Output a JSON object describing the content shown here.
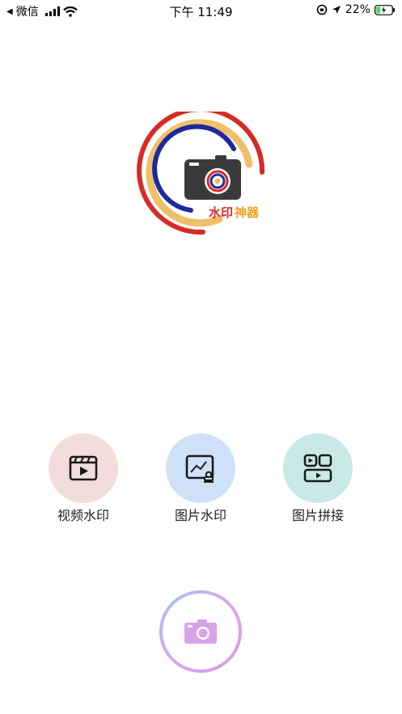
{
  "status_bar": {
    "back_app": "微信",
    "time": "下午 11:49",
    "battery_percent": "22%"
  },
  "logo": {
    "text_part1": "水印",
    "text_part2": "神器"
  },
  "features": [
    {
      "label": "视频水印",
      "icon": "video-clapper-icon",
      "bg_color": "#f3dcdc"
    },
    {
      "label": "图片水印",
      "icon": "image-stamp-icon",
      "bg_color": "#cfe1f8"
    },
    {
      "label": "图片拼接",
      "icon": "collage-grid-icon",
      "bg_color": "#c9e8e6"
    }
  ],
  "camera_button": {
    "icon": "camera-icon",
    "accent": "#d9a3ea"
  }
}
